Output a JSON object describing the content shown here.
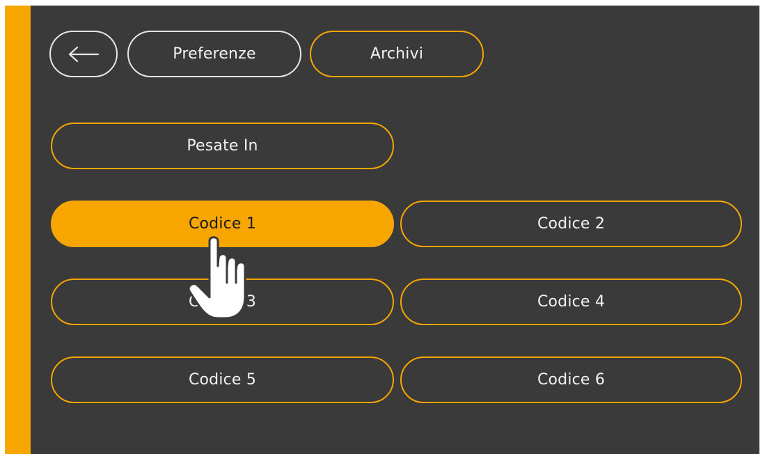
{
  "colors": {
    "accent": "#f7a600",
    "background": "#3a3a3a",
    "text": "#f2f2f2",
    "active_text": "#1a1a1a"
  },
  "nav": {
    "back_icon": "arrow-left-icon",
    "preferences_label": "Preferenze",
    "archives_label": "Archivi"
  },
  "menu": {
    "weighings_in_label": "Pesate In",
    "codes": [
      {
        "label": "Codice 1",
        "active": true
      },
      {
        "label": "Codice 2",
        "active": false
      },
      {
        "label": "Codice 3",
        "active": false
      },
      {
        "label": "Codice 4",
        "active": false
      },
      {
        "label": "Codice 5",
        "active": false
      },
      {
        "label": "Codice 6",
        "active": false
      }
    ]
  },
  "pointer": {
    "icon": "hand-pointer-icon"
  }
}
